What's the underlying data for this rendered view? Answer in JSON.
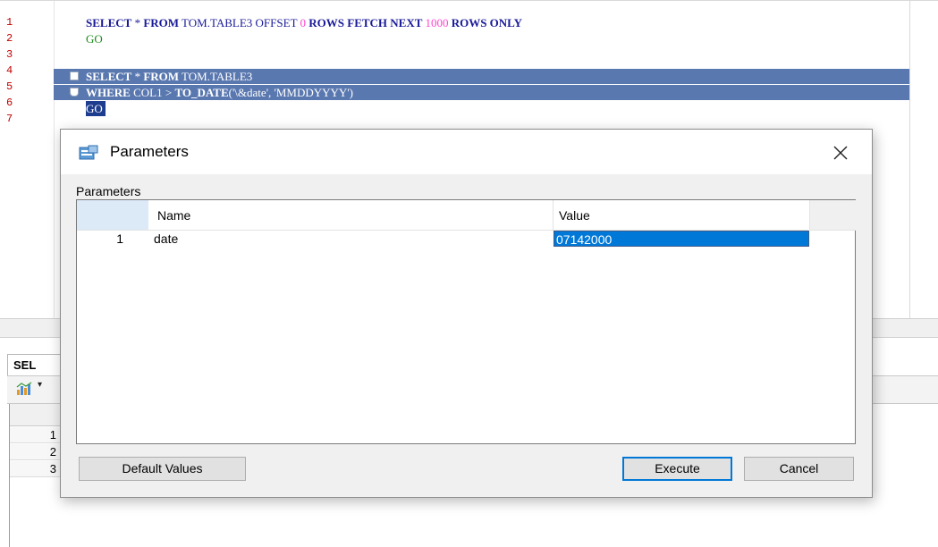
{
  "editor": {
    "line_numbers": [
      "1",
      "2",
      "3",
      "4",
      "5",
      "6",
      "7"
    ],
    "line1": {
      "kw1": "SELECT",
      "op1": " * ",
      "kw2": "FROM",
      "nm1": " TOM.TABLE3 ",
      "nm2": "OFFSET ",
      "num1": "0",
      "kw3": " ROWS FETCH NEXT ",
      "num2": "1000",
      "kw4": " ROWS ONLY"
    },
    "line2": "GO",
    "line4": {
      "kw1": "SELECT",
      "op1": " * ",
      "kw2": "FROM",
      "nm1": " TOM.TABLE3"
    },
    "line5": {
      "kw1": "WHERE",
      "nm1": " COL1 > ",
      "kw2": "TO_DATE",
      "str1": "('\\&date', 'MMDDYYYY')"
    },
    "line6": "GO"
  },
  "results": {
    "tab_label": "SEL",
    "row_numbers": [
      "1",
      "2",
      "3"
    ]
  },
  "dialog": {
    "title": "Parameters",
    "group_label": "Parameters",
    "columns": {
      "name": "Name",
      "value": "Value"
    },
    "rows": [
      {
        "num": "1",
        "name": "date",
        "value": "07142000"
      }
    ],
    "buttons": {
      "default_values": "Default Values",
      "execute": "Execute",
      "cancel": "Cancel"
    }
  }
}
